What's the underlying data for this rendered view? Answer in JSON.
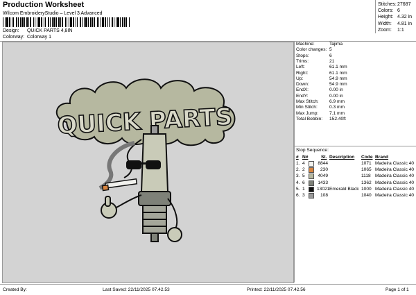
{
  "header": {
    "title": "Production Worksheet",
    "subtitle": "Wilcom EmbroideryStudio – Level 3 Advanced",
    "design_label": "Design:",
    "design_value": "QUICK PARTS 4,8IN",
    "colorway_label": "Colorway:",
    "colorway_value": "Colorway 1"
  },
  "summary": {
    "rows": [
      {
        "key": "Stitches:",
        "value": "27687"
      },
      {
        "key": "Colors:",
        "value": "6"
      },
      {
        "key": "Height:",
        "value": "4.32 in"
      },
      {
        "key": "Width:",
        "value": "4.81 in"
      },
      {
        "key": "Zoom:",
        "value": "1:1"
      }
    ]
  },
  "design": {
    "logo_text": "QUICK PARTS"
  },
  "machine_info": {
    "rows": [
      {
        "key": "Machine:",
        "value": "Tajima"
      },
      {
        "key": "Color changes:",
        "value": "5"
      },
      {
        "key": "Stops:",
        "value": "6"
      },
      {
        "key": "Trims:",
        "value": "21"
      },
      {
        "key": "Left:",
        "value": "61.1 mm"
      },
      {
        "key": "Right:",
        "value": "61.1 mm"
      },
      {
        "key": "Up:",
        "value": "54.9 mm"
      },
      {
        "key": "Down:",
        "value": "54.9 mm"
      },
      {
        "key": "EndX:",
        "value": "0.00 in"
      },
      {
        "key": "EndY:",
        "value": "0.00 in"
      },
      {
        "key": "Max Stitch:",
        "value": "6.9 mm"
      },
      {
        "key": "Min Stitch:",
        "value": "0.3 mm"
      },
      {
        "key": "Max Jump:",
        "value": "7.1 mm"
      },
      {
        "key": "Total Bobbin:",
        "value": "152.40ft"
      }
    ]
  },
  "stop_sequence": {
    "title": "Stop Sequence:",
    "headers": {
      "num": "#",
      "n": "N#",
      "st": "St.",
      "description": "Description",
      "code": "Code",
      "brand": "Brand"
    },
    "rows": [
      {
        "num": "1.",
        "n": "4",
        "color": "#f2f2ee",
        "st": "8844",
        "description": "",
        "code": "1071",
        "brand": "Madeira Classic 40"
      },
      {
        "num": "2.",
        "n": "2",
        "color": "#d7843f",
        "st": "230",
        "description": "",
        "code": "1065",
        "brand": "Madeira Classic 40"
      },
      {
        "num": "3.",
        "n": "5",
        "color": "#b6b8a0",
        "st": "4049",
        "description": "",
        "code": "1118",
        "brand": "Madeira Classic 40"
      },
      {
        "num": "4.",
        "n": "6",
        "color": "#7e8178",
        "st": "1433",
        "description": "",
        "code": "1362",
        "brand": "Madeira Classic 40"
      },
      {
        "num": "5.",
        "n": "1",
        "color": "#111111",
        "st": "13021",
        "description": "Emerald Black",
        "code": "1000",
        "brand": "Madeira Classic 40"
      },
      {
        "num": "6.",
        "n": "3",
        "color": "#9a9a9a",
        "st": "108",
        "description": "",
        "code": "1040",
        "brand": "Madeira Classic 40"
      }
    ]
  },
  "footer": {
    "created_by": "Created By:",
    "last_saved": "Last Saved: 22/11/2025 07.42.53",
    "printed": "Printed: 22/11/2025 07.42.56",
    "page": "Page 1 of 1"
  },
  "colors": {
    "background": "#d3d3d3",
    "smoke": "#b6b8a0",
    "outline": "#111111",
    "cigarette_tip": "#d7843f"
  }
}
